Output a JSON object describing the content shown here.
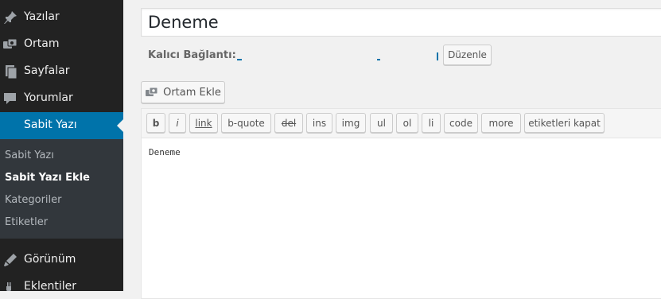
{
  "sidebar": {
    "items": [
      {
        "label": "Yazılar",
        "icon": "pin-icon"
      },
      {
        "label": "Ortam",
        "icon": "media-icon"
      },
      {
        "label": "Sayfalar",
        "icon": "pages-icon"
      },
      {
        "label": "Yorumlar",
        "icon": "comments-icon"
      },
      {
        "label": "Sabit Yazı",
        "icon": "",
        "active": true
      },
      {
        "label": "Görünüm",
        "icon": "appearance-icon"
      },
      {
        "label": "Eklentiler",
        "icon": "plugins-icon"
      }
    ],
    "submenu": [
      {
        "label": "Sabit Yazı"
      },
      {
        "label": "Sabit Yazı Ekle",
        "current": true
      },
      {
        "label": "Kategoriler"
      },
      {
        "label": "Etiketler"
      }
    ],
    "colors": {
      "bg": "#222222",
      "active": "#0073aa",
      "submenu_bg": "#32373c"
    }
  },
  "post": {
    "title": "Deneme",
    "permalink_label": "Kalıcı Bağlantı:",
    "edit_button": "Düzenle"
  },
  "media_button": {
    "label": "Ortam Ekle",
    "icon": "media-icon"
  },
  "quicktags": [
    "b",
    "i",
    "link",
    "b-quote",
    "del",
    "ins",
    "img",
    "ul",
    "ol",
    "li",
    "code",
    "more",
    "etiketleri kapat"
  ],
  "editor": {
    "content": "Deneme"
  }
}
